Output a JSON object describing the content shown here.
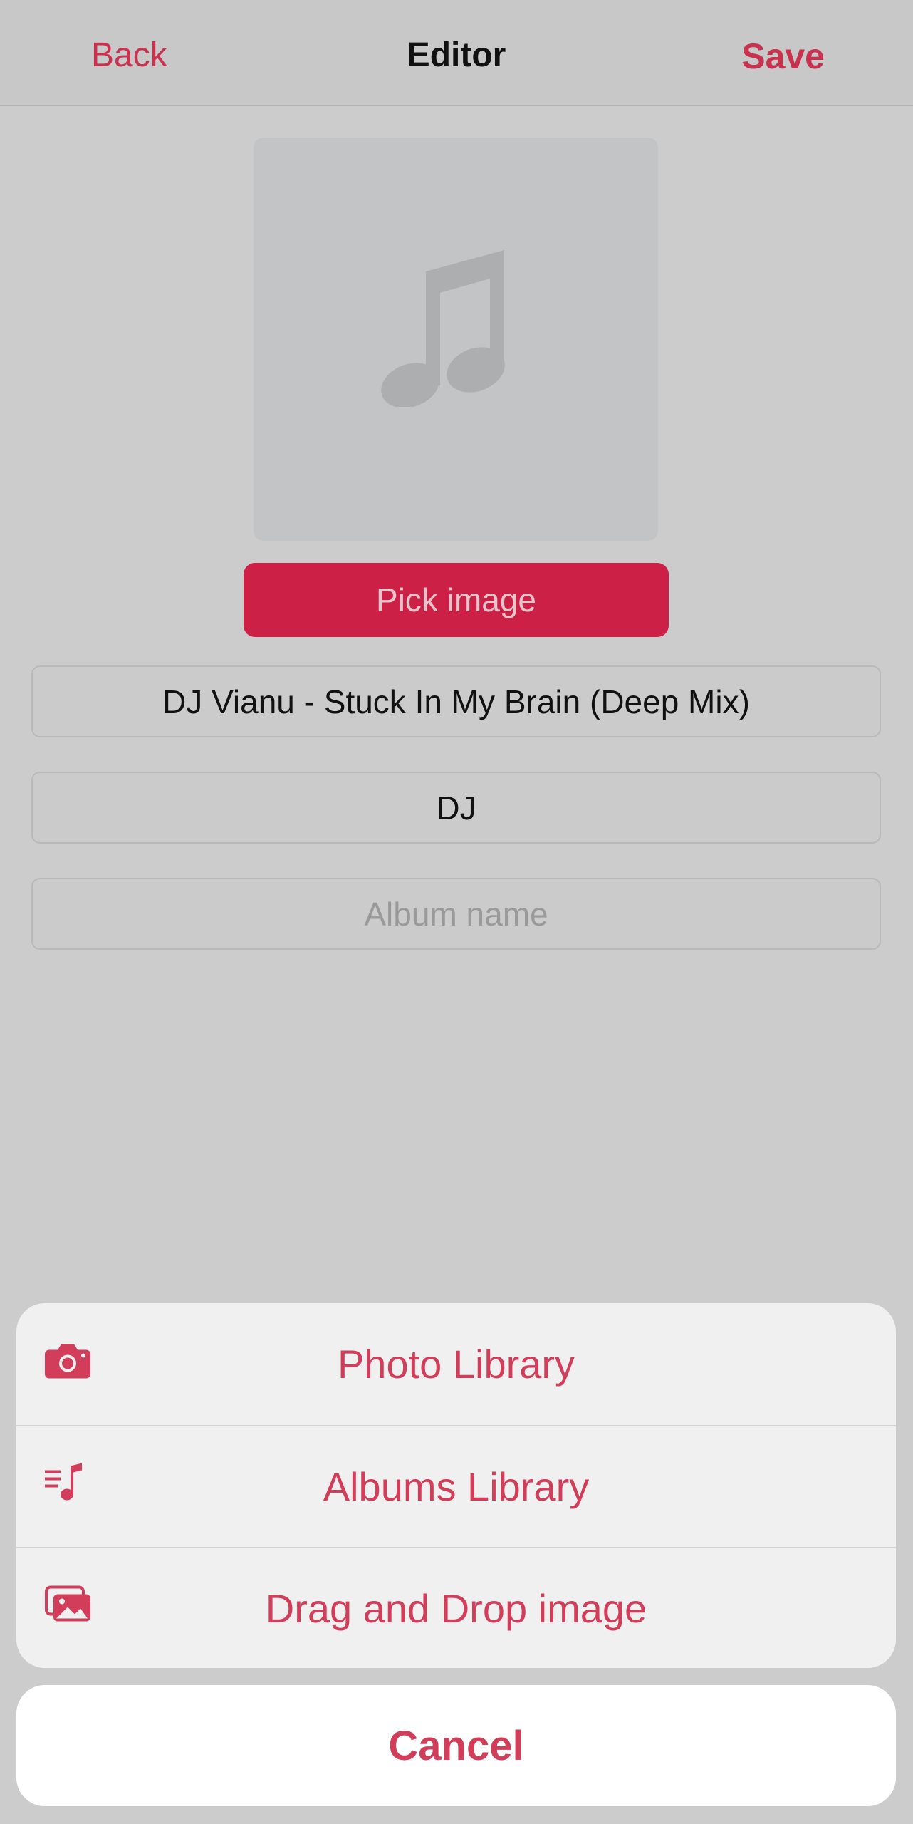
{
  "nav": {
    "back_label": "Back",
    "title": "Editor",
    "save_label": "Save"
  },
  "artwork": {
    "placeholder_icon": "music-note-icon"
  },
  "pick_image_label": "Pick image",
  "fields": {
    "title_value": "DJ Vianu - Stuck In My Brain (Deep Mix)",
    "artist_value": "DJ",
    "album_placeholder": "Album name"
  },
  "action_sheet": {
    "items": [
      {
        "label": "Photo Library",
        "icon": "camera-icon"
      },
      {
        "label": "Albums Library",
        "icon": "music-list-icon"
      },
      {
        "label": "Drag and Drop image",
        "icon": "photos-icon"
      }
    ],
    "cancel_label": "Cancel"
  },
  "colors": {
    "accent": "#d23d5a",
    "button_fill": "#cc2046",
    "dim_background": "#cccccc"
  }
}
